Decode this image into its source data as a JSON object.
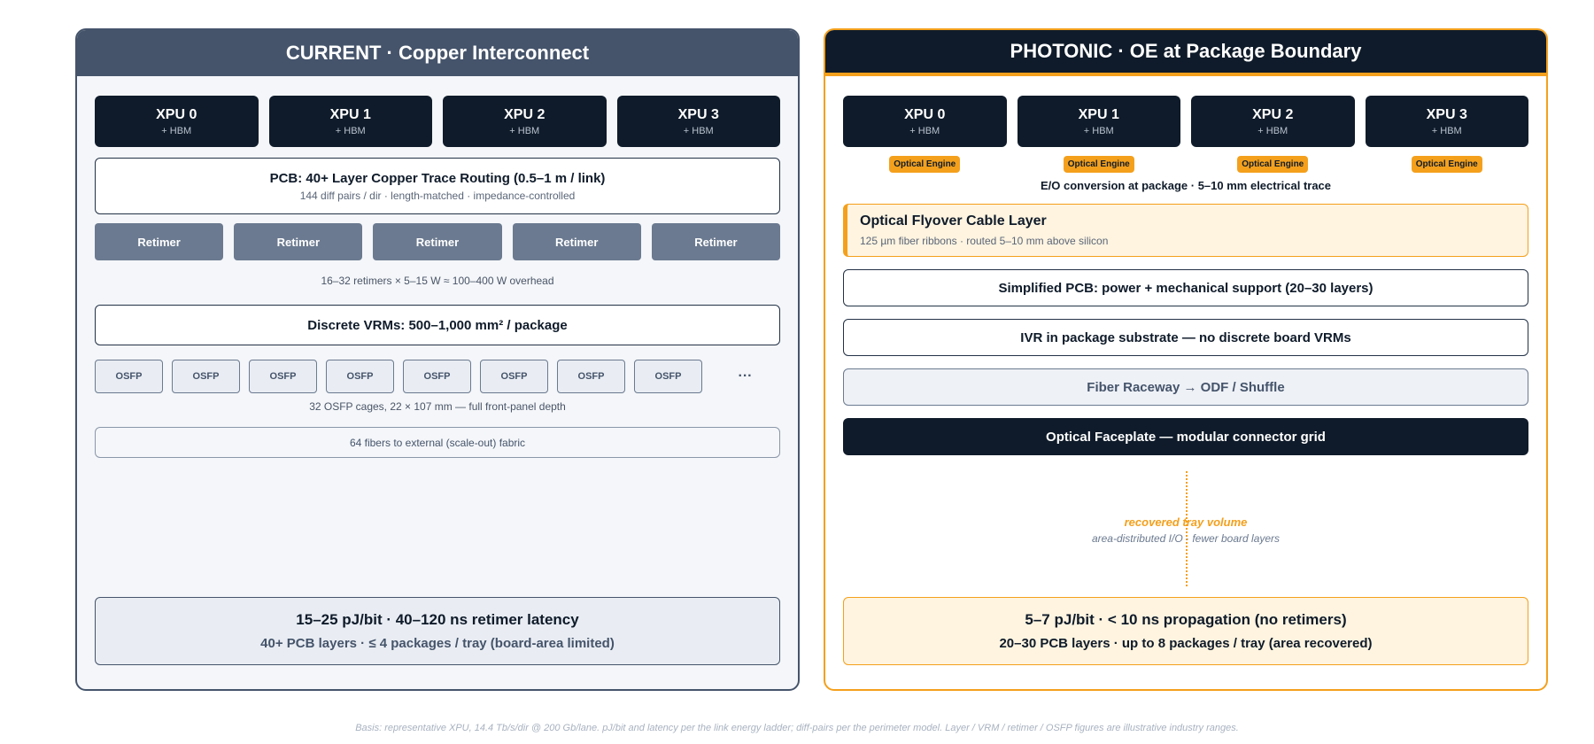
{
  "left": {
    "title": "CURRENT · Copper Interconnect",
    "xpus": [
      {
        "name": "XPU 0",
        "sub": "+ HBM"
      },
      {
        "name": "XPU 1",
        "sub": "+ HBM"
      },
      {
        "name": "XPU 2",
        "sub": "+ HBM"
      },
      {
        "name": "XPU 3",
        "sub": "+ HBM"
      }
    ],
    "pcb": {
      "title": "PCB: 40+ Layer Copper Trace Routing (0.5–1 m / link)",
      "sub": "144 diff pairs / dir · length-matched · impedance-controlled"
    },
    "retimers": [
      "Retimer",
      "Retimer",
      "Retimer",
      "Retimer",
      "Retimer"
    ],
    "retimer_caption": "16–32 retimers × 5–15 W ≈ 100–400 W overhead",
    "vrm": "Discrete VRMs: 500–1,000 mm² / package",
    "osfp": [
      "OSFP",
      "OSFP",
      "OSFP",
      "OSFP",
      "OSFP",
      "OSFP",
      "OSFP",
      "OSFP"
    ],
    "osfp_more": "···",
    "osfp_caption": "32 OSFP cages, 22 × 107 mm — full front-panel depth",
    "fibers": "64 fibers to external (scale-out) fabric",
    "summary": {
      "main": "15–25 pJ/bit · 40–120 ns retimer latency",
      "sub": "40+ PCB layers · ≤ 4 packages / tray (board-area limited)"
    }
  },
  "right": {
    "title": "PHOTONIC · OE at Package Boundary",
    "xpus": [
      {
        "name": "XPU 0",
        "sub": "+ HBM"
      },
      {
        "name": "XPU 1",
        "sub": "+ HBM"
      },
      {
        "name": "XPU 2",
        "sub": "+ HBM"
      },
      {
        "name": "XPU 3",
        "sub": "+ HBM"
      }
    ],
    "optical_engines": [
      "Optical Engine",
      "Optical Engine",
      "Optical Engine",
      "Optical Engine"
    ],
    "eo_caption": "E/O conversion at package · 5–10 mm electrical trace",
    "flyover": {
      "title": "Optical Flyover Cable Layer",
      "sub": "125 µm fiber ribbons · routed 5–10 mm above silicon"
    },
    "simplified_pcb": "Simplified PCB: power + mechanical support (20–30 layers)",
    "ivr": "IVR in package substrate — no discrete board VRMs",
    "raceway": "Fiber Raceway → ODF / Shuffle",
    "faceplate": "Optical Faceplate — modular connector grid",
    "recovered": {
      "title": "recovered tray volume",
      "sub": "area-distributed I/O · fewer board layers"
    },
    "summary": {
      "main": "5–7 pJ/bit · < 10 ns propagation (no retimers)",
      "sub": "20–30 PCB layers · up to 8 packages / tray (area recovered)"
    }
  },
  "footnote": "Basis: representative XPU, 14.4 Tb/s/dir @ 200 Gb/lane. pJ/bit and latency per the link energy ladder; diff-pairs per the perimeter model. Layer / VRM / retimer / OSFP figures are illustrative industry ranges.",
  "colors": {
    "navy": "#0f1b2a",
    "slate": "#45546b",
    "accent": "#f4a01c",
    "retimer": "#6b7a90"
  }
}
